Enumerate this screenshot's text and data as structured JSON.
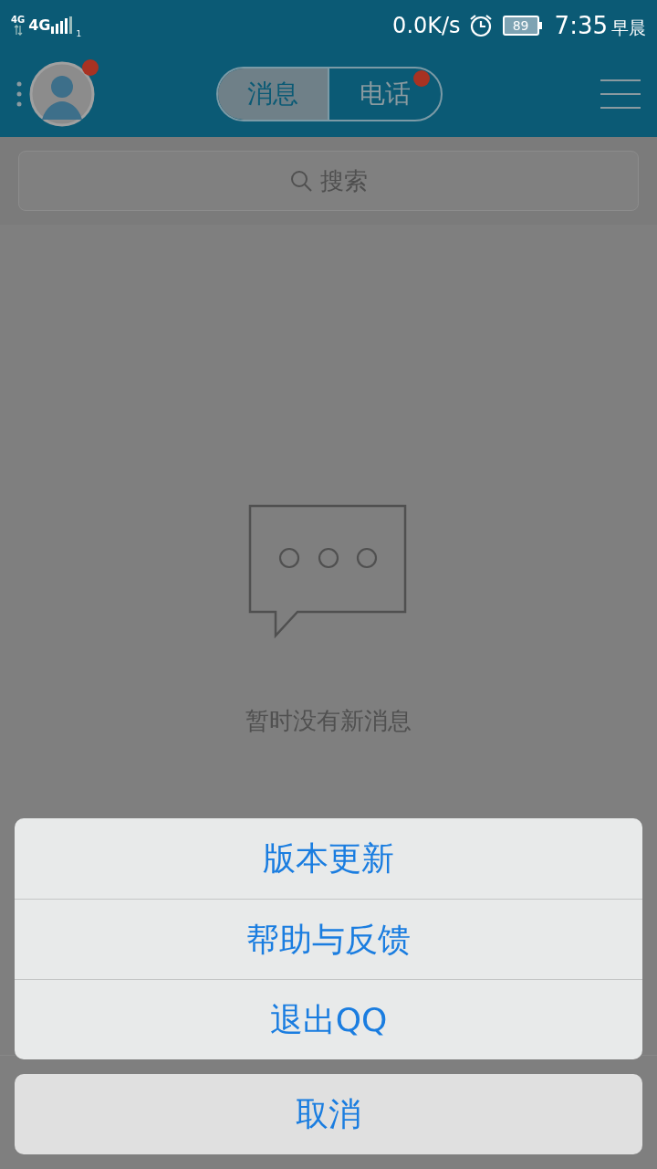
{
  "status_bar": {
    "network_small": "4G",
    "network": "4G",
    "sim": "1",
    "speed": "0.0K/s",
    "battery": "89",
    "time": "7:35",
    "period": "早晨"
  },
  "header": {
    "avatar_badge": true,
    "segments": [
      {
        "label": "消息",
        "selected": true,
        "badge": false
      },
      {
        "label": "电话",
        "selected": false,
        "badge": true
      }
    ]
  },
  "search": {
    "placeholder": "搜索"
  },
  "empty_state": {
    "message": "暂时没有新消息"
  },
  "action_sheet": {
    "items": [
      "版本更新",
      "帮助与反馈",
      "退出QQ"
    ],
    "cancel": "取消"
  }
}
